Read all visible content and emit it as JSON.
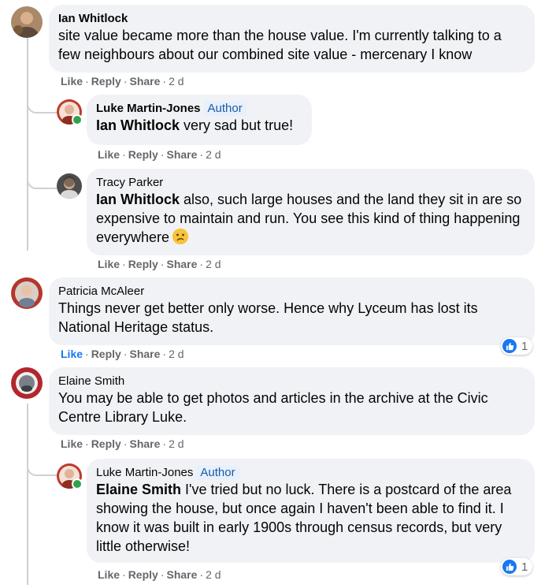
{
  "actions": {
    "like": "Like",
    "reply": "Reply",
    "share": "Share",
    "sep": "·"
  },
  "author_badge": "Author",
  "comments": [
    {
      "name": "Ian Whitlock",
      "text": "site value became more than the house value. I'm currently talking to a few neighbours about our combined site value - mercenary I know",
      "time": "2 d"
    },
    {
      "name": "Luke Martin-Jones",
      "mention": "Ian Whitlock",
      "text": " very sad but true!",
      "time": "2 d"
    },
    {
      "name": "Tracy Parker",
      "mention": "Ian Whitlock",
      "text": " also, such large houses and the land they sit in are so expensive to maintain and run. You see this kind of thing happening everywhere",
      "time": "2 d"
    },
    {
      "name": "Patricia McAleer",
      "text": "Things never get better only worse. Hence why Lyceum has lost its National Heritage status.",
      "time": "2 d",
      "reactions": "1"
    },
    {
      "name": "Elaine Smith",
      "text": "You may be able to get photos and articles in the archive at the Civic Centre Library Luke.",
      "time": "2 d"
    },
    {
      "name": "Luke Martin-Jones",
      "mention": "Elaine Smith",
      "text": " I've tried but no luck. There is a postcard of the area showing the house, but once again I haven't been able to find it. I know it was built in early 1900s through census records, but very little otherwise!",
      "time": "2 d",
      "reactions": "1"
    }
  ],
  "colors": {
    "link_blue": "#1877f2",
    "bubble": "#f0f2f5",
    "meta_gray": "#65676b",
    "online_green": "#31a24c"
  },
  "icons": {
    "emoji": "confused-face-icon",
    "reaction": "like-reaction-icon"
  }
}
